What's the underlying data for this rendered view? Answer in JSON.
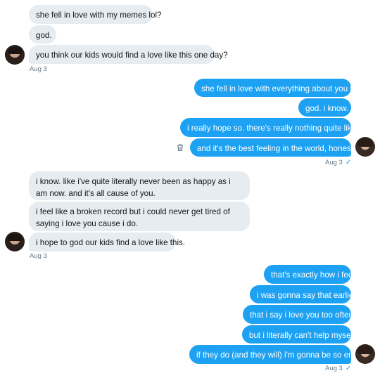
{
  "messages": {
    "g1": [
      "she fell in love with my memes lol?",
      "god.",
      "you think our kids would find a love like this one day?"
    ],
    "g1_time": "Aug 3",
    "g2": [
      "she fell in love with everything about you lol.",
      "god. i know.",
      "i really hope so. there's really nothing quite like it.",
      "and it's the best feeling in the world, honestly."
    ],
    "g2_time": "Aug 3",
    "g3": [
      "i know. like i've quite literally never been as happy as i am now. and it's all cause of you.",
      "i feel like a broken record but i could never get tired of saying i love you cause i do.",
      "i hope to god our kids find a love like this."
    ],
    "g3_time": "Aug 3",
    "g4": [
      "that's exactly how i feel.",
      "i was gonna say that earlier.",
      "that i say i love you too often.",
      "but i literally can't help myself.",
      "if they do (and they will) i'm gonna be so emo."
    ],
    "g4_time": "Aug 3",
    "read_icon": "checkmark-icon",
    "delete_icon": "trash-icon"
  }
}
